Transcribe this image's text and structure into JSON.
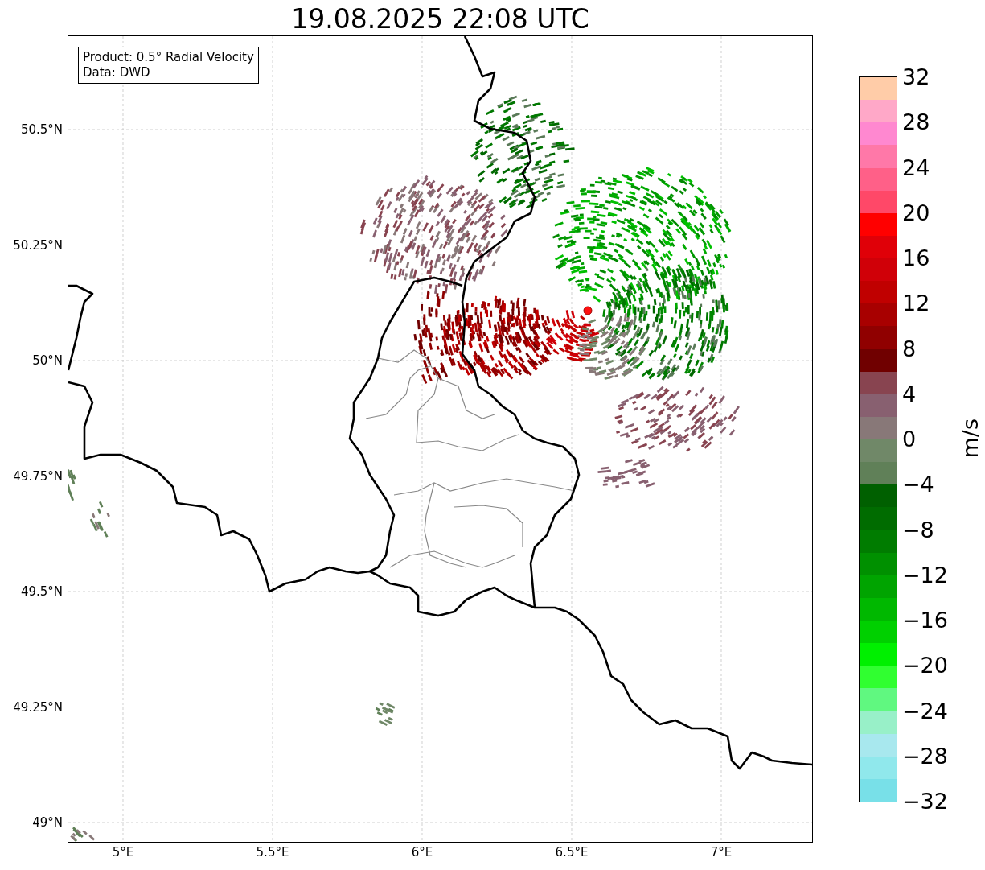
{
  "title": "19.08.2025 22:08 UTC",
  "info_box": [
    "Product: 0.5° Radial Velocity",
    "Data: DWD"
  ],
  "x_ticks": [
    "5°E",
    "5.5°E",
    "6°E",
    "6.5°E",
    "7°E"
  ],
  "y_ticks": [
    "50.5°N",
    "50.25°N",
    "50°N",
    "49.75°N",
    "49.5°N",
    "49.25°N",
    "49°N"
  ],
  "colorbar": {
    "label": "m/s",
    "bands": [
      {
        "color": "#ffcca8"
      },
      {
        "color": "#ffa8c8"
      },
      {
        "color": "#ff88d0"
      },
      {
        "color": "#ff78a8"
      },
      {
        "color": "#ff6088"
      },
      {
        "color": "#ff4868"
      },
      {
        "color": "#ff0000"
      },
      {
        "color": "#e00008"
      },
      {
        "color": "#d00008"
      },
      {
        "color": "#c00000"
      },
      {
        "color": "#a80000"
      },
      {
        "color": "#900000"
      },
      {
        "color": "#700000"
      },
      {
        "color": "#884450"
      },
      {
        "color": "#886070"
      },
      {
        "color": "#887878"
      },
      {
        "color": "#708868"
      },
      {
        "color": "#608058"
      },
      {
        "color": "#006000"
      },
      {
        "color": "#006c00"
      },
      {
        "color": "#007c00"
      },
      {
        "color": "#009000"
      },
      {
        "color": "#00a400"
      },
      {
        "color": "#00b800"
      },
      {
        "color": "#00d000"
      },
      {
        "color": "#00f000"
      },
      {
        "color": "#30ff30"
      },
      {
        "color": "#60f880"
      },
      {
        "color": "#98f0c8"
      },
      {
        "color": "#a8e8ee"
      },
      {
        "color": "#90e8ec"
      },
      {
        "color": "#78e0e8"
      }
    ],
    "ticks": [
      "32",
      "28",
      "24",
      "20",
      "16",
      "12",
      "8",
      "4",
      "0",
      "−4",
      "−8",
      "−12",
      "−16",
      "−20",
      "−24",
      "−28",
      "−32"
    ]
  }
}
